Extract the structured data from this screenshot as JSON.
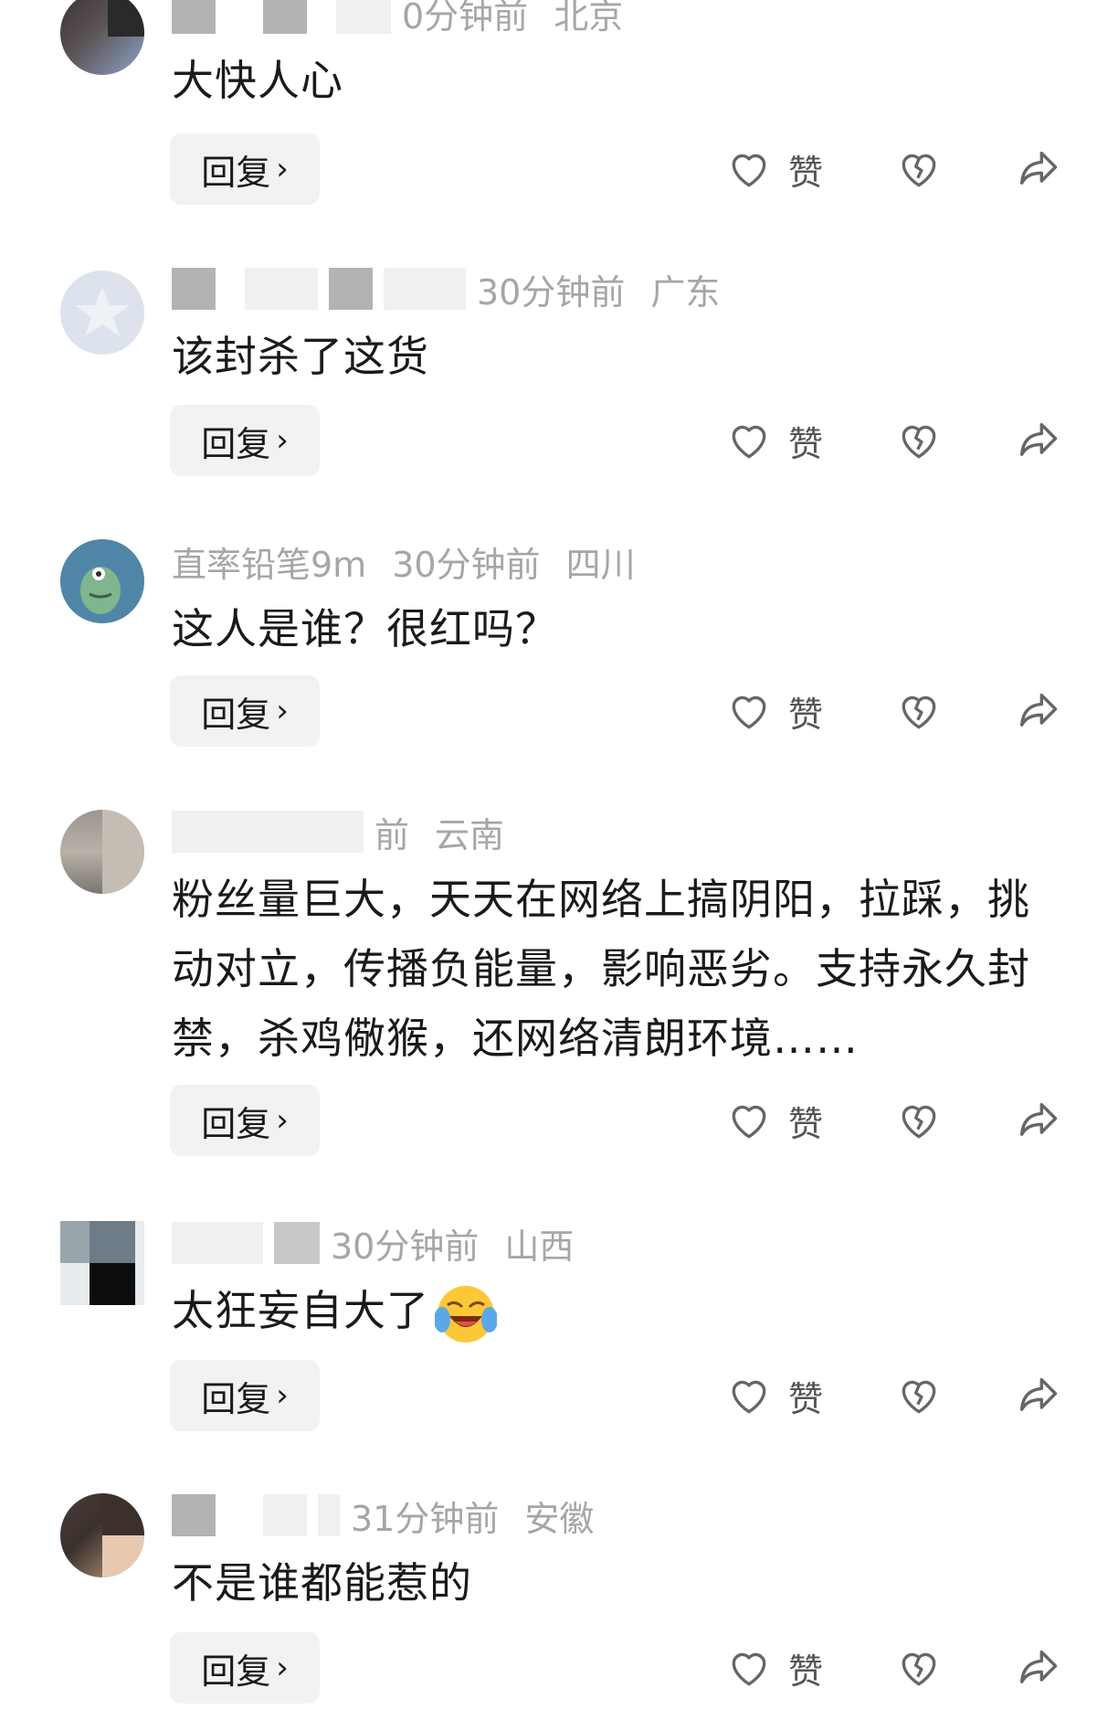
{
  "comments": [
    {
      "name": "",
      "time": "0分钟前",
      "location": "北京",
      "text": "大快人心",
      "reply_label": "回复",
      "like_label": "赞"
    },
    {
      "name": "",
      "time": "30分钟前",
      "location": "广东",
      "text": "该封杀了这货",
      "reply_label": "回复",
      "like_label": "赞"
    },
    {
      "name": "直率铅笔9m",
      "time": "30分钟前",
      "location": "四川",
      "text": "这人是谁？很红吗？",
      "reply_label": "回复",
      "like_label": "赞"
    },
    {
      "name": "",
      "time": "前",
      "location": "云南",
      "text": "粉丝量巨大，天天在网络上搞阴阳，拉踩，挑动对立，传播负能量，影响恶劣。支持永久封禁，杀鸡儆猴，还网络清朗环境……",
      "reply_label": "回复",
      "like_label": "赞"
    },
    {
      "name": "",
      "time": "30分钟前",
      "location": "山西",
      "text": "太狂妄自大了",
      "reply_label": "回复",
      "like_label": "赞"
    },
    {
      "name": "",
      "time": "31分钟前",
      "location": "安徽",
      "text": "不是谁都能惹的",
      "reply_label": "回复",
      "like_label": "赞"
    }
  ],
  "icons": {
    "like": "heart-icon",
    "dislike": "broken-heart-icon",
    "share": "share-arrow-icon",
    "reply_chevron": "chevron-right-icon",
    "emoji": "laughing-crying-emoji"
  },
  "colors": {
    "meta_gray": "#a6a6a6",
    "reply_bg": "#f2f2f2",
    "icon_gray": "#666666"
  }
}
